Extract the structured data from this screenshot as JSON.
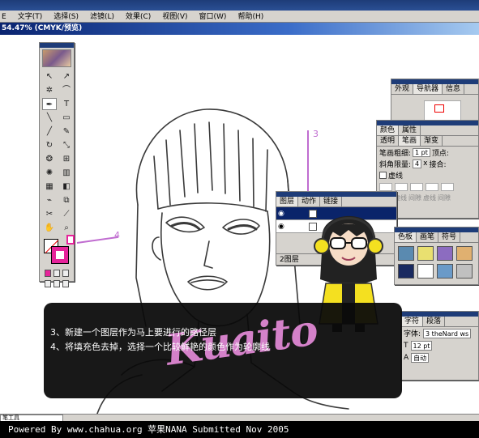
{
  "menubar": {
    "items": [
      "文字(T)",
      "选择(S)",
      "滤镜(L)",
      "效果(C)",
      "视图(V)",
      "窗口(W)",
      "帮助(H)"
    ],
    "partial_left": "E"
  },
  "document": {
    "title": "54.47% (CMYK/预览)"
  },
  "callouts": {
    "three": "3",
    "four": "4"
  },
  "panels": {
    "navigator": {
      "tabs": [
        "外观",
        "导航器",
        "信息"
      ]
    },
    "stroke": {
      "tabs": [
        "颜色",
        "属性"
      ],
      "tabs2": [
        "透明",
        "笔画",
        "渐变"
      ],
      "weight_label": "笔画粗细:",
      "weight_value": "1 pt",
      "cap_label": "顶点:",
      "miter_label": "斜角限量:",
      "miter_value": "4",
      "miter_unit": "x",
      "join_label": "接合:",
      "dashed_label": "虚线",
      "dash_labels": [
        "间隙",
        "虚线",
        "间隙",
        "虚线",
        "间隙"
      ]
    },
    "layers": {
      "tabs": [
        "图层",
        "动作",
        "链接"
      ],
      "footer": "2图层"
    },
    "swatches": {
      "tabs": [
        "色板",
        "画笔",
        "符号"
      ]
    },
    "character": {
      "tabs": [
        "字符",
        "段落"
      ],
      "font_label": "字体:",
      "font_value": "3 theNard ws",
      "size_value": "12 pt",
      "leading_value": "自动"
    }
  },
  "caption": {
    "line1": "3、新建一个图层作为马上要进行的路径层",
    "line2": "4、将填充色去掉，选择一个比较鲜艳的颜色作为轮廓线",
    "signature": "Kuaito"
  },
  "statusbar": {
    "tool": "笔工具"
  },
  "footer": {
    "credit": "Powered By www.chahua.org  苹果NANA  Submitted Nov 2005"
  }
}
